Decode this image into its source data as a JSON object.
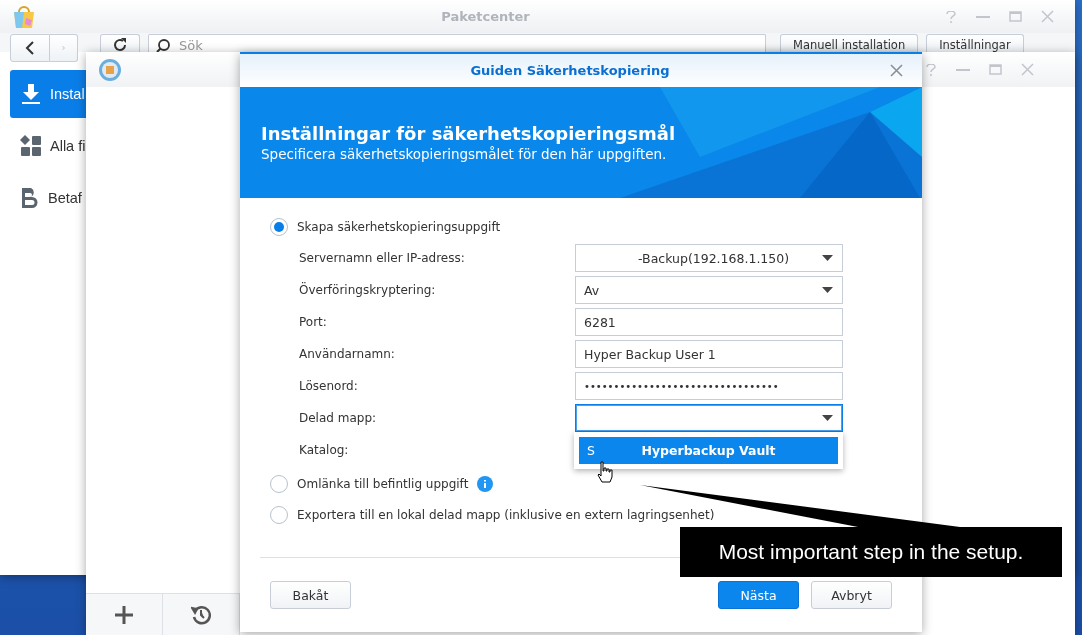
{
  "package_center": {
    "title": "Paketcenter",
    "search": {
      "placeholder": "Sök"
    },
    "buttons": [
      "Manuell installation",
      "Inställningar"
    ],
    "sidebar": {
      "items": [
        {
          "label": "Instal",
          "selected": true
        },
        {
          "label": "Alla fi",
          "selected": false
        },
        {
          "label": "Betaf",
          "selected": false
        }
      ]
    }
  },
  "wizard": {
    "title": "Guiden Säkerhetskopiering",
    "banner": {
      "title": "Inställningar för säkerhetskopieringsmål",
      "subtitle": "Specificera säkerhetskopieringsmålet för den här uppgiften."
    },
    "options": [
      {
        "label": "Skapa säkerhetskopieringsuppgift",
        "selected": true,
        "info": false
      },
      {
        "label": "Omlänka till befintlig uppgift",
        "selected": false,
        "info": true
      },
      {
        "label": "Exportera till en lokal delad mapp (inklusive en extern lagringsenhet)",
        "selected": false,
        "info": false
      }
    ],
    "fields": [
      {
        "label": "Servernamn eller IP-adress:",
        "kind": "select",
        "value": "-Backup(192.168.1.150)",
        "focused": false
      },
      {
        "label": "Överföringskryptering:",
        "kind": "select",
        "value": "Av",
        "focused": false
      },
      {
        "label": "Port:",
        "kind": "text",
        "value": "6281",
        "focused": false
      },
      {
        "label": "Användarnamn:",
        "kind": "text",
        "value": "Hyper Backup User 1",
        "focused": false
      },
      {
        "label": "Lösenord:",
        "kind": "password",
        "value": "•••••••••••••••••••••••••••••••••",
        "focused": false
      },
      {
        "label": "Delad mapp:",
        "kind": "select",
        "focused": true
      },
      {
        "label": "Katalog:",
        "kind": "none"
      }
    ],
    "dropdown": {
      "items": [
        {
          "prefix": "S",
          "label": "Hyperbackup Vault",
          "selected": true
        }
      ]
    },
    "footer": {
      "back": "Bakåt",
      "next": "Nästa",
      "cancel": "Avbryt"
    }
  },
  "callout": {
    "text": "Most important step in the setup."
  }
}
